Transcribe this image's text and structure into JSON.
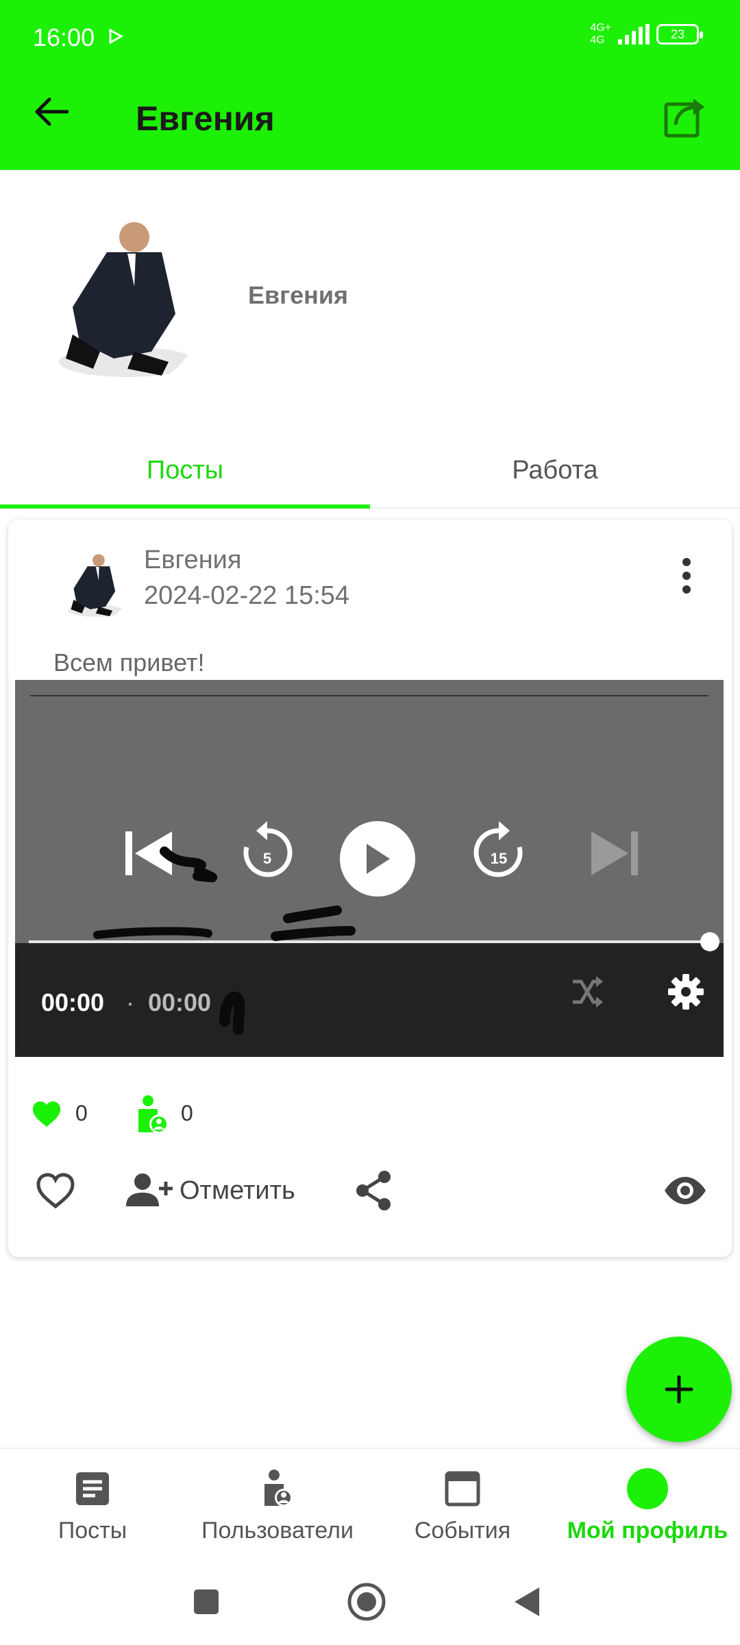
{
  "status_bar": {
    "time": "16:00",
    "network_label_top": "4G+",
    "network_label_bottom": "4G",
    "battery_level": "23"
  },
  "app_bar": {
    "title": "Евгения",
    "back_icon": "arrow-left-icon",
    "share_icon": "share-export-icon"
  },
  "profile": {
    "name": "Евгения"
  },
  "tabs": [
    {
      "label": "Посты",
      "active": true
    },
    {
      "label": "Работа",
      "active": false
    }
  ],
  "post": {
    "author": "Евгения",
    "date": "2024-02-22 15:54",
    "text": "Всем привет!",
    "player": {
      "current_time": "00:00",
      "separator": "·",
      "duration": "00:00",
      "rewind_seconds": "5",
      "forward_seconds": "15"
    },
    "stats": {
      "likes": "0",
      "marks": "0"
    },
    "actions": {
      "mark_label": "Отметить"
    }
  },
  "colors": {
    "accent": "#1cf006",
    "accent_text": "#1bd80a",
    "player_bg": "#6b6b6b",
    "player_bar": "#222222"
  },
  "bottom_nav": [
    {
      "label": "Посты",
      "icon": "article-icon",
      "active": false
    },
    {
      "label": "Пользователи",
      "icon": "user-icon",
      "active": false
    },
    {
      "label": "События",
      "icon": "window-icon",
      "active": false
    },
    {
      "label": "Мой профиль",
      "icon": "profile-circle-icon",
      "active": true
    }
  ]
}
